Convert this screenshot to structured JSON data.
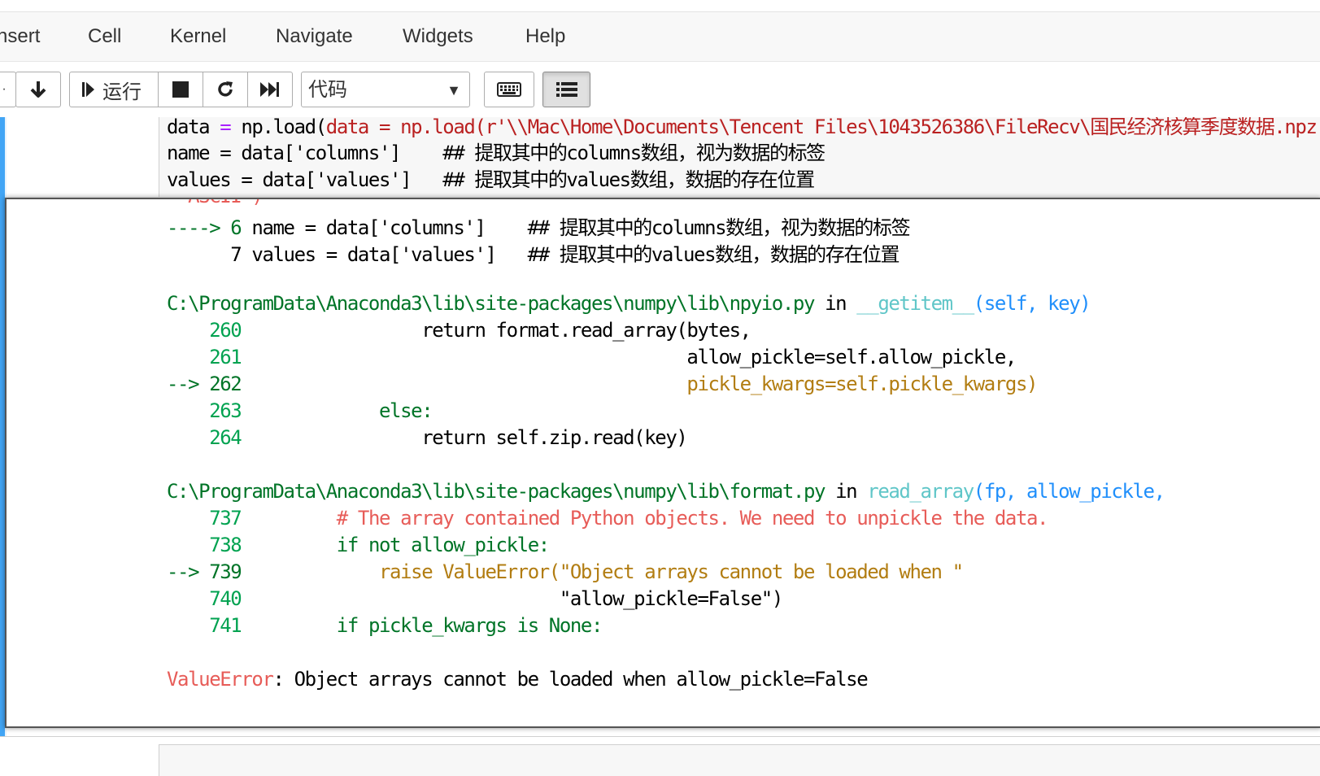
{
  "menu": [
    "nsert",
    "Cell",
    "Kernel",
    "Navigate",
    "Widgets",
    "Help"
  ],
  "toolbar": {
    "run_label": "运行",
    "cell_type": "代码",
    "cell_type_caret": "▼"
  },
  "code_cell": {
    "lines": [
      "data = np.load(r'\\\\Mac\\Home\\Documents\\Tencent Files\\1043526386\\FileRecv\\国民经济核算季度数据.npz',enc",
      "name = data['columns']    ## 提取其中的columns数组，视为数据的标签",
      "values = data['values']   ## 提取其中的values数组，数据的存在位置"
    ]
  },
  "traceback": {
    "partial_top": "  ASCII')",
    "arrow6": "----> 6 ",
    "line6_code": "name = data['columns']    ## 提取其中的columns数组，视为数据的标签",
    "line7": "      7 values = data['values']   ## 提取其中的values数组，数据的存在位置",
    "frame1_path": "C:\\ProgramData\\Anaconda3\\lib\\site-packages\\numpy\\lib\\npyio.py",
    "frame1_in": " in ",
    "frame1_func": "__getitem__",
    "frame1_args": "(self, key)",
    "l260_no": "    260",
    "l260": "                 return format.read_array(bytes,",
    "l261_no": "    261",
    "l261": "                                          allow_pickle=self.allow_pickle,",
    "l262_no": "--> 262",
    "l262": "                                          pickle_kwargs=self.pickle_kwargs)",
    "l263_no": "    263",
    "l263": "             else:",
    "l264_no": "    264",
    "l264": "                 return self.zip.read(key)",
    "frame2_path": "C:\\ProgramData\\Anaconda3\\lib\\site-packages\\numpy\\lib\\format.py",
    "frame2_in": " in ",
    "frame2_func": "read_array",
    "frame2_args": "(fp, allow_pickle,",
    "l737_no": "    737",
    "l737": "         # The array contained Python objects. We need to unpickle the data.",
    "l738_no": "    738",
    "l738": "         if not allow_pickle:",
    "l739_no": "--> 739",
    "l739": "             raise ValueError(\"Object arrays cannot be loaded when \"",
    "l740_no": "    740",
    "l740": "                              \"allow_pickle=False\")",
    "l741_no": "    741",
    "l741": "         if pickle_kwargs is None:",
    "err_name": "ValueError",
    "err_msg": ": Object arrays cannot be loaded when allow_pickle=False"
  }
}
